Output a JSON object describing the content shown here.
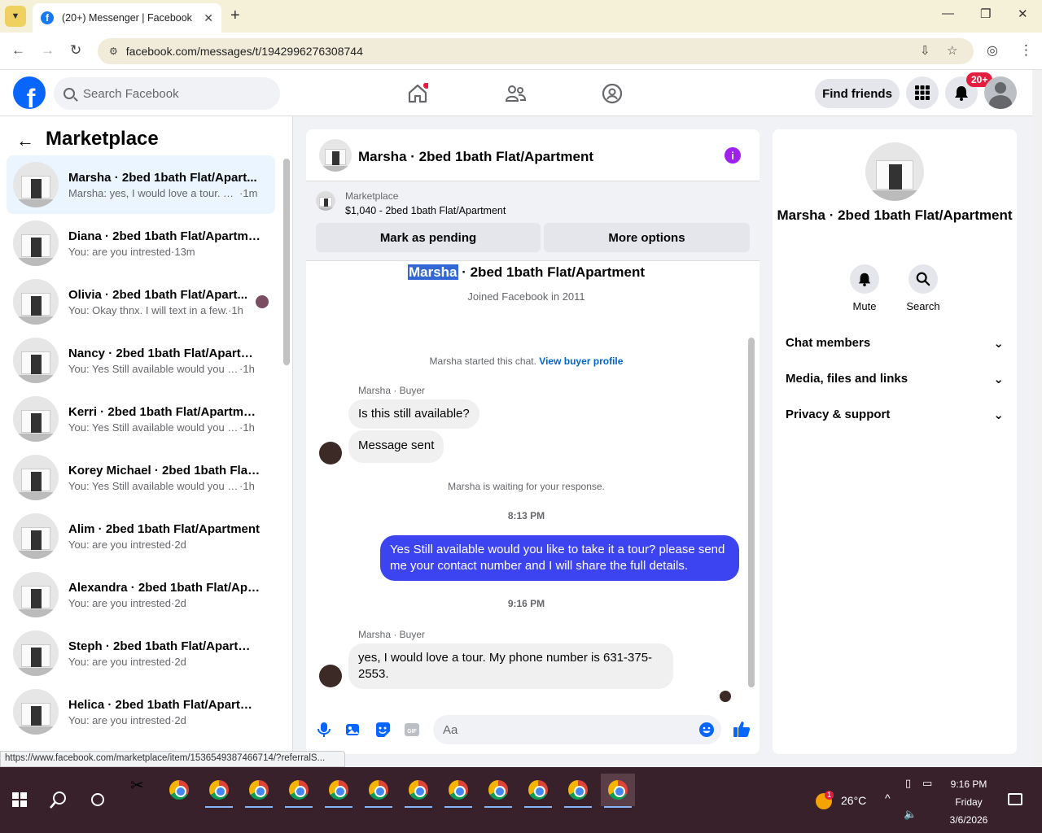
{
  "browser": {
    "tab_title": "(20+) Messenger | Facebook",
    "url": "facebook.com/messages/t/1942996276308744",
    "status_url": "https://www.facebook.com/marketplace/item/1536549387466714/?referralS..."
  },
  "header": {
    "search_placeholder": "Search Facebook",
    "find_friends": "Find friends",
    "notif_badge": "20+"
  },
  "left": {
    "title": "Marketplace",
    "conversations": [
      {
        "name": "Marsha · 2bed 1bath Flat/Apart...",
        "preview": "Marsha: yes, I would love a tour. M...",
        "time": "1m",
        "active": true
      },
      {
        "name": "Diana · 2bed 1bath Flat/Apartme...",
        "preview": "You: are you intrested",
        "time": "13m"
      },
      {
        "name": "Olivia · 2bed 1bath Flat/Apart...",
        "preview": "You: Okay thnx. I will text in a few.",
        "time": "1h",
        "seen": true
      },
      {
        "name": "Nancy · 2bed 1bath Flat/Apartm...",
        "preview": "You: Yes Still available would you lik...",
        "time": "1h"
      },
      {
        "name": "Kerri · 2bed 1bath Flat/Apartment",
        "preview": "You: Yes Still available would you lik...",
        "time": "1h"
      },
      {
        "name": "Korey Michael · 2bed 1bath Flat/...",
        "preview": "You: Yes Still available would you lik...",
        "time": "1h"
      },
      {
        "name": "Alim · 2bed 1bath Flat/Apartment",
        "preview": "You: are you intrested",
        "time": "2d"
      },
      {
        "name": "Alexandra · 2bed 1bath Flat/Apa...",
        "preview": "You: are you intrested",
        "time": "2d"
      },
      {
        "name": "Steph · 2bed 1bath Flat/Apartme...",
        "preview": "You: are you intrested",
        "time": "2d"
      },
      {
        "name": "Helica · 2bed 1bath Flat/Apartm...",
        "preview": "You: are you intrested",
        "time": "2d"
      }
    ]
  },
  "chat": {
    "title": "Marsha · 2bed 1bath Flat/Apartment",
    "marketplace_label": "Marketplace",
    "listing": "$1,040 - 2bed 1bath Flat/Apartment",
    "mark_pending": "Mark as pending",
    "more_options": "More options",
    "intro_name_highlight": "Marsha",
    "intro_rest": " · 2bed 1bath Flat/Apartment",
    "joined": "Joined Facebook in 2011",
    "started_text": "Marsha started this chat.",
    "view_buyer": "View buyer profile",
    "sender_label": "Marsha · Buyer",
    "msg1": "Is this still available?",
    "msg2": "Message sent",
    "waiting": "Marsha is waiting for your response.",
    "time1": "8:13 PM",
    "out_msg": "Yes Still available would you like to take it a tour? please send me your contact number and I will share the full details.",
    "time2": "9:16 PM",
    "sender_label2": "Marsha · Buyer",
    "msg3": "yes, I would love a tour. My phone number is 631-375-2553.",
    "composer_placeholder": "Aa"
  },
  "right": {
    "name": "Marsha · 2bed 1bath Flat/Apartment",
    "mute": "Mute",
    "search": "Search",
    "rows": [
      "Chat members",
      "Media, files and links",
      "Privacy & support"
    ]
  },
  "taskbar": {
    "temp": "26°C",
    "time": "9:16 PM",
    "day": "Friday",
    "date": "3/6/2026",
    "weather_badge": "1"
  },
  "colors": {
    "fb_blue": "#0866ff",
    "out_bubble": "#3c44f2",
    "info": "#a020f0",
    "badge": "#e41e3f"
  }
}
